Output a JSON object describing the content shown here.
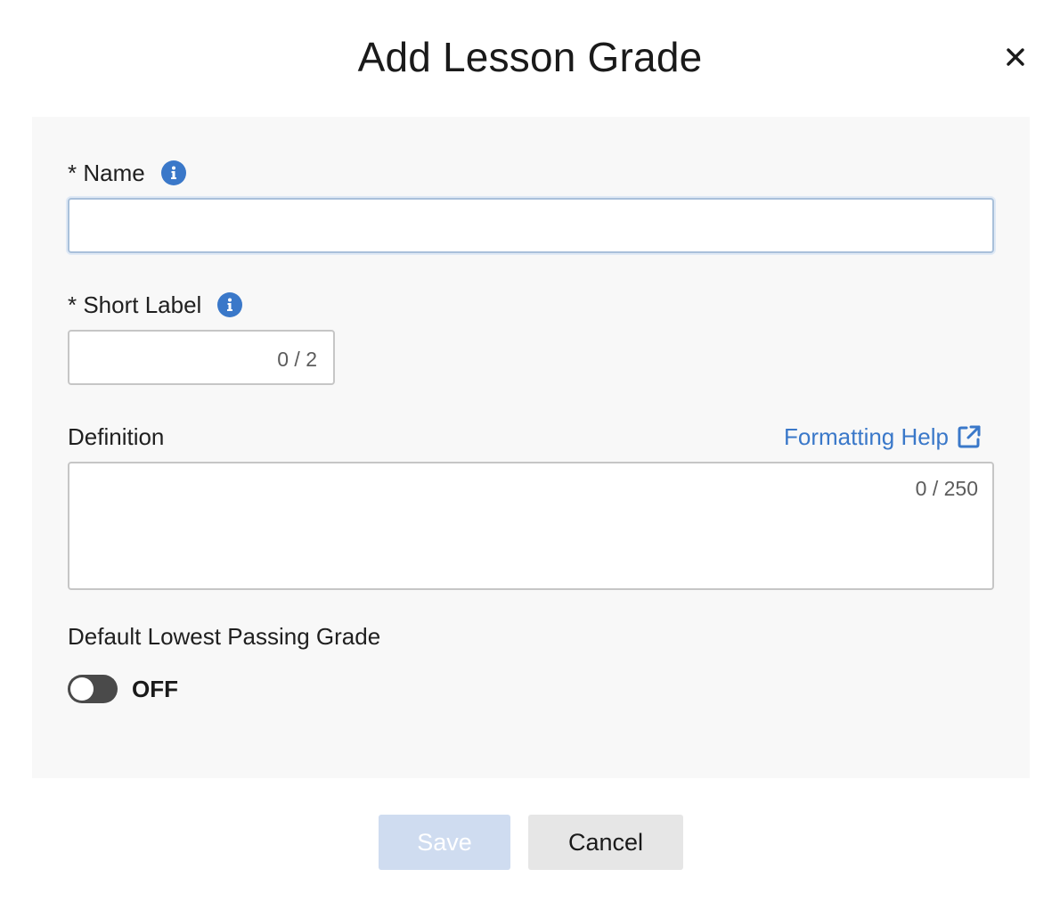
{
  "dialog": {
    "title": "Add Lesson Grade",
    "close_icon": "close-icon"
  },
  "form": {
    "name": {
      "label": "* Name",
      "value": "",
      "placeholder": "",
      "info_icon": "info-icon"
    },
    "short_label": {
      "label": "* Short Label",
      "value": "",
      "counter": "0 / 2",
      "info_icon": "info-icon"
    },
    "definition": {
      "label": "Definition",
      "value": "",
      "counter": "0 / 250",
      "help_link": "Formatting Help",
      "help_icon": "external-link-icon"
    },
    "lowest_passing": {
      "label": "Default Lowest Passing Grade",
      "toggle_state": "OFF",
      "toggle_on": false
    }
  },
  "footer": {
    "save_label": "Save",
    "cancel_label": "Cancel"
  },
  "colors": {
    "accent": "#3a78c9",
    "panel_bg": "#f8f8f8",
    "save_disabled_bg": "#cfdcf0",
    "cancel_bg": "#e6e6e6",
    "toggle_off": "#4a4a4a"
  }
}
